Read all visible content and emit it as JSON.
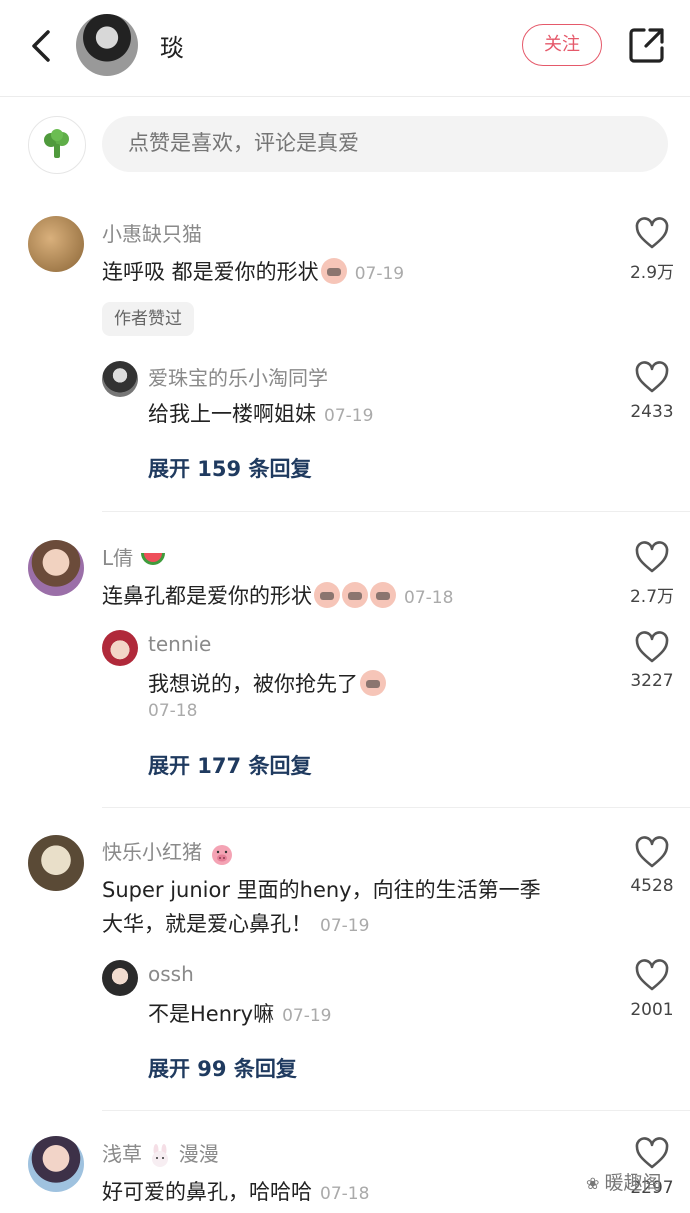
{
  "header": {
    "author_name": "琰",
    "follow_label": "关注"
  },
  "composer": {
    "placeholder": "点赞是喜欢，评论是真爱"
  },
  "comments": [
    {
      "user": "小惠缺只猫",
      "text": "连呼吸 都是爱你的形状",
      "date": "07-19",
      "likes": "2.9万",
      "badge": "作者赞过",
      "reply": {
        "user": "爱珠宝的乐小淘同学",
        "text": "给我上一楼啊姐妹",
        "date": "07-19",
        "likes": "2433"
      },
      "expand": "展开 159 条回复"
    },
    {
      "user": "L倩",
      "text": "连鼻孔都是爱你的形状",
      "date": "07-18",
      "likes": "2.7万",
      "reply": {
        "user": "tennie",
        "text": "我想说的，被你抢先了",
        "date": "07-18",
        "likes": "3227"
      },
      "expand": "展开 177 条回复"
    },
    {
      "user": "快乐小红猪",
      "text_line1": "Super junior 里面的heny，向往的生活第一季",
      "text_line2": "大华，就是爱心鼻孔！",
      "date": "07-19",
      "likes": "4528",
      "reply": {
        "user": "ossh",
        "text": "不是Henry嘛",
        "date": "07-19",
        "likes": "2001"
      },
      "expand": "展开 99 条回复"
    },
    {
      "user_part1": "浅草",
      "user_part2": "漫漫",
      "text": "好可爱的鼻孔，哈哈哈",
      "date": "07-18",
      "likes": "2297"
    }
  ],
  "watermark": "暖趣阁",
  "colors": {
    "accent": "#e5596a",
    "expand_link": "#1f3a5f"
  },
  "icons": [
    "back-arrow-icon",
    "share-icon",
    "heart-icon",
    "broccoli-icon",
    "watermelon-icon",
    "pig-icon",
    "rabbit-icon"
  ]
}
